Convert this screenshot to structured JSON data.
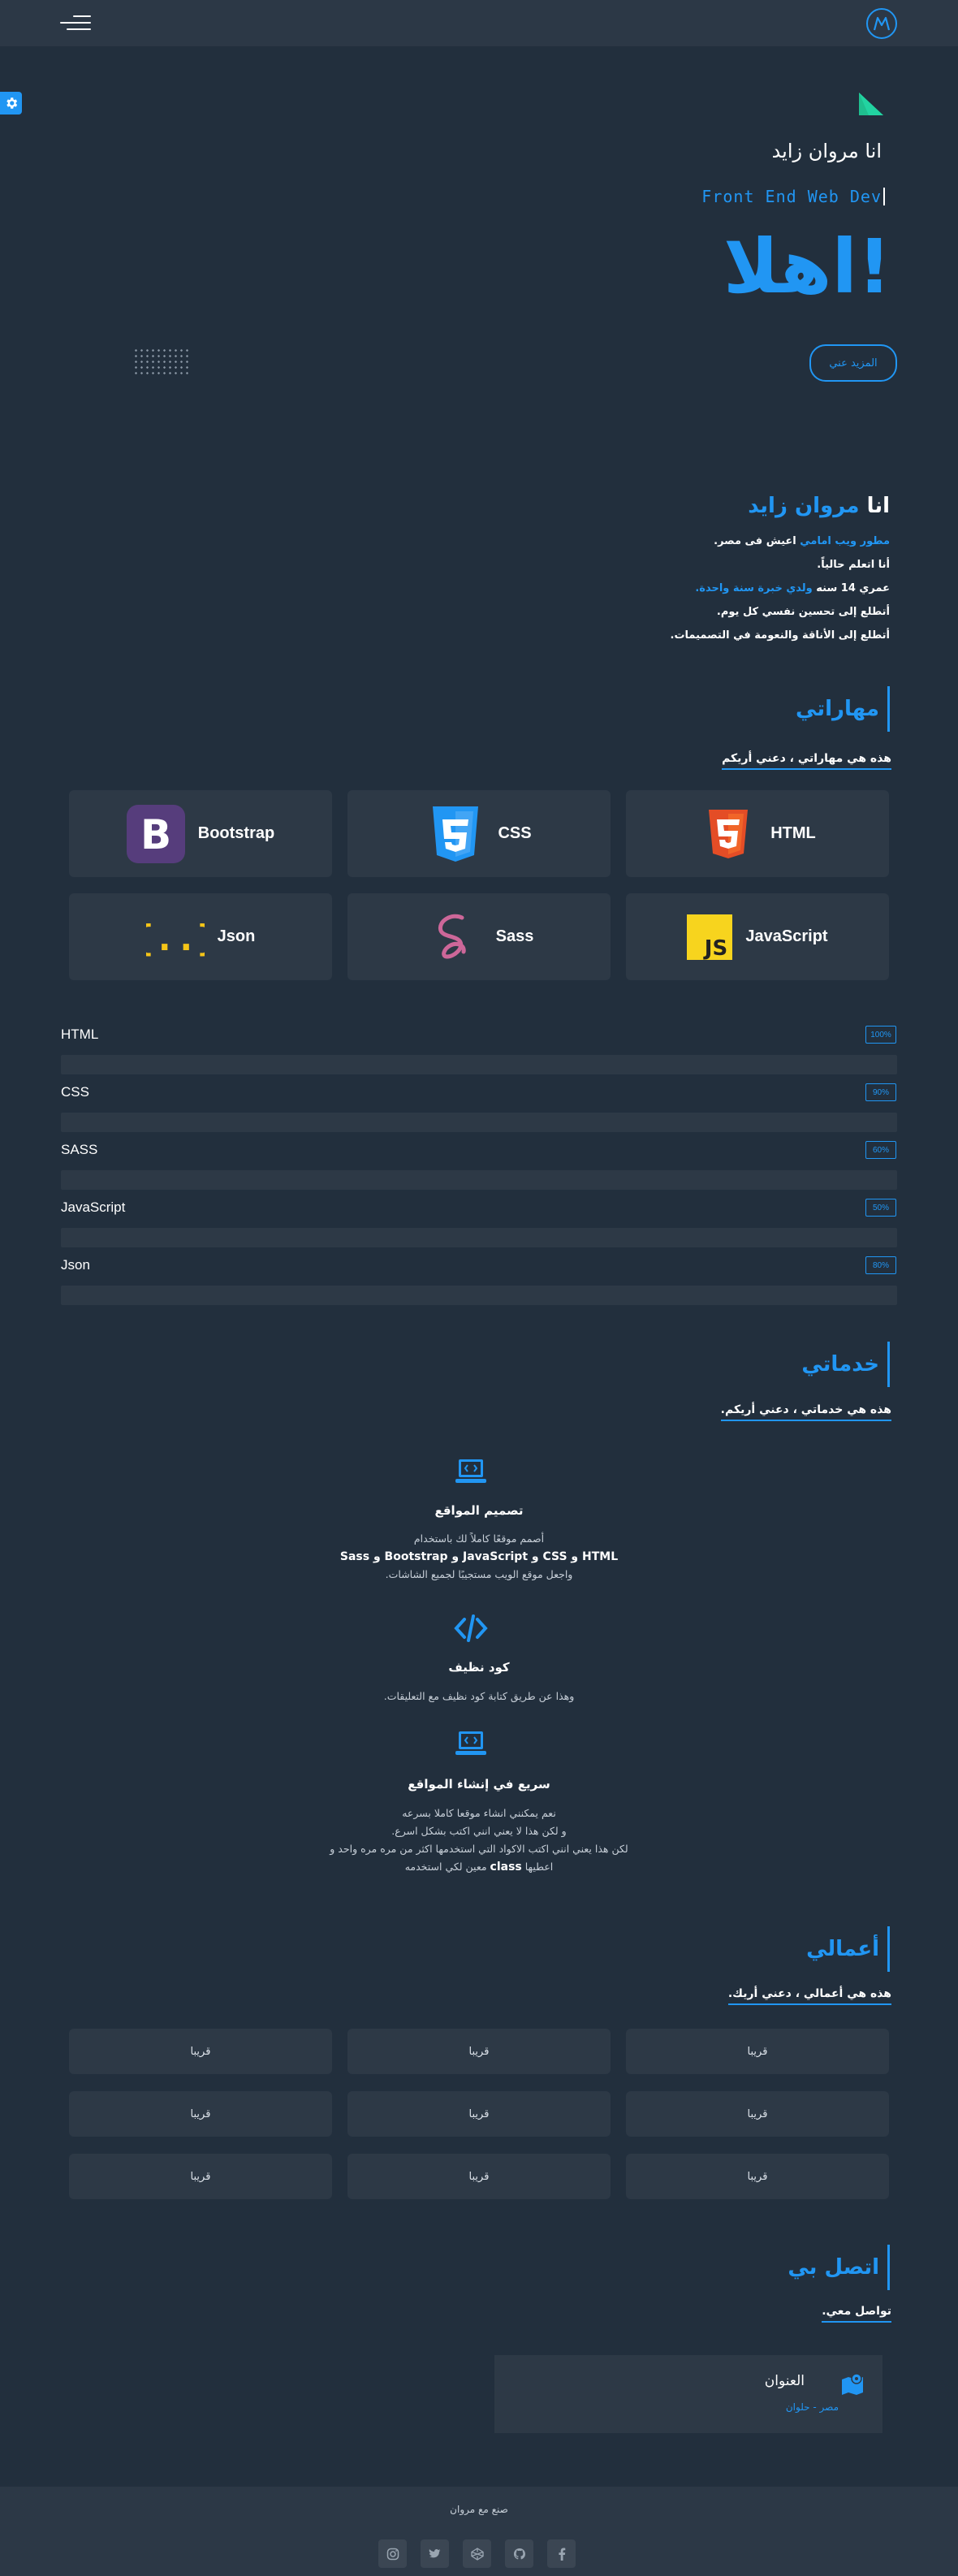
{
  "colors": {
    "background": "#222f3d",
    "surface": "#2d3946",
    "accent": "#2196f3",
    "navbar": "#2c3846"
  },
  "navbar": {
    "brand_text": "M",
    "menu_icon": "hamburger-icon",
    "brand_icon": "logo-m-icon"
  },
  "settings": {
    "icon": "gear-icon"
  },
  "hero": {
    "name": "انا مروان زايد",
    "role": "Front End Web Dev",
    "greeting": "اهلا!",
    "more_button": "المزيد عني"
  },
  "about": {
    "title_prefix": "انا",
    "title_name": "مروان زايد",
    "line1_accent": "مطور ويب امامي",
    "line1_rest": "اعيش فى مصر.",
    "line2": "أنا اتعلم حالياً.",
    "line3_start": "عمري 14 سنه",
    "line3_accent": "ولدي خبرة سنة واحدة.",
    "line4": "أتطلع إلى تحسين نفسي كل يوم.",
    "line5": "أتطلع إلى الأناقة والنعومة في التصميمات."
  },
  "skills": {
    "title": "مهاراتي",
    "subtitle": "هذه هي مهاراتي ، دعني أريكم",
    "cards": [
      {
        "label": "Bootstrap",
        "icon": "bootstrap-icon"
      },
      {
        "label": "CSS",
        "icon": "css3-icon"
      },
      {
        "label": "HTML",
        "icon": "html5-icon"
      },
      {
        "label": "Json",
        "icon": "json-icon"
      },
      {
        "label": "Sass",
        "icon": "sass-icon"
      },
      {
        "label": "JavaScript",
        "icon": "javascript-icon"
      }
    ],
    "progress": [
      {
        "label": "HTML",
        "badge": "100%",
        "value": 100
      },
      {
        "label": "CSS",
        "badge": "90%",
        "value": 90
      },
      {
        "label": "SASS",
        "badge": "60%",
        "value": 60
      },
      {
        "label": "JavaScript",
        "badge": "50%",
        "value": 50
      },
      {
        "label": "Json",
        "badge": "80%",
        "value": 80
      }
    ]
  },
  "services": {
    "title": "خدماتي",
    "subtitle": "هذه هي خدماتي ، دعني أريكم.",
    "items": [
      {
        "title": "تصميم المواقع",
        "icon": "laptop-code-icon",
        "line1": "أصمم موقعًا كاملاً لك باستخدام",
        "line2": "HTML و CSS و JavaScript و Bootstrap و Sass",
        "line3": "واجعل موقع الويب مستجيبًا لجميع الشاشات."
      },
      {
        "title": "كود نظيف",
        "icon": "code-icon",
        "line1": "وهذا عن طريق كتابة كود نظيف مع التعليقات."
      },
      {
        "title": "سريع في إنشاء المواقع",
        "icon": "laptop-code-icon",
        "line1": "نعم يمكنني انشاء موقعا كاملا بسرعه",
        "line2": "و لكن هذا لا يعني انني اكتب بشكل اسرع.",
        "line3": "لكن هذا يعني انني اكتب الاكواد التي استخدمها اكثر من مره مره واحد و",
        "line4_start": "اعطيها",
        "line4_bold": "class",
        "line4_end": "معين لكي استخدمه"
      }
    ]
  },
  "works": {
    "title": "أعمالي",
    "subtitle": "هذه هي أعمالي ، دعني أريك.",
    "items": [
      "قريبا",
      "قريبا",
      "قريبا",
      "قريبا",
      "قريبا",
      "قريبا",
      "قريبا",
      "قريبا",
      "قريبا"
    ]
  },
  "contact": {
    "title": "اتصل بي",
    "subtitle": "تواصل معي.",
    "card_title": "العنوان",
    "card_value": "مصر - حلوان",
    "card_icon": "map-location-icon"
  },
  "footer": {
    "text": "صنع مع مروان",
    "social": [
      "facebook-icon",
      "github-icon",
      "codepen-icon",
      "twitter-icon",
      "instagram-icon"
    ]
  }
}
